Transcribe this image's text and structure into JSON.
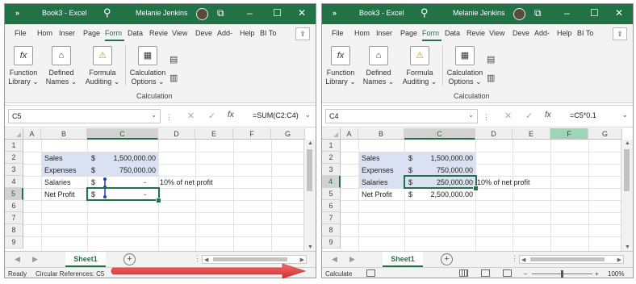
{
  "colors": {
    "excel_green": "#217346",
    "selected_band": "#d9e1f2",
    "tracer_blue": "#1f3fbf",
    "arrow_red": "#e03b3b"
  },
  "app": {
    "chevron": "»",
    "doc_title": "Book3 - Excel",
    "search_icon": "⚲",
    "user_name": "Melanie Jenkins",
    "restore_icon": "⧉",
    "minimize_icon": "–",
    "maximize_icon": "☐",
    "close_icon": "✕"
  },
  "menu": [
    "File",
    "Hom",
    "Inser",
    "Page",
    "Form",
    "Data",
    "Revie",
    "View",
    "Deve",
    "Add-",
    "Help",
    "BI To"
  ],
  "share_icon": "⇪",
  "ribbon": {
    "function_library": "Function Library ⌄",
    "function_library_l1": "Function",
    "function_library_l2": "Library ⌄",
    "defined_names_l1": "Defined",
    "defined_names_l2": "Names ⌄",
    "formula_auditing_l1": "Formula",
    "formula_auditing_l2": "Auditing ⌄",
    "calc_options_l1": "Calculation",
    "calc_options_l2": "Options ⌄",
    "group_label": "Calculation",
    "fx_icon": "fx",
    "names_icon": "⌂",
    "auditing_icon": "⚠",
    "calc_icon": "▦",
    "calc_now_icon": "▤",
    "calc_sheet_icon": "▥"
  },
  "formula_bar": {
    "dropdown": "⌄",
    "dots": "⋮",
    "cancel": "✕",
    "enter": "✓",
    "fx": "fx"
  },
  "columns": [
    "A",
    "B",
    "C",
    "D",
    "E",
    "F",
    "G"
  ],
  "rows": [
    "1",
    "2",
    "3",
    "4",
    "5",
    "6",
    "7",
    "8",
    "9"
  ],
  "left": {
    "name_box": "C5",
    "formula": "=SUM(C2:C4)",
    "cells": {
      "b2": "Sales",
      "b3": "Expenses",
      "b4": "Salaries",
      "b5": "Net Profit",
      "c_currency": "$",
      "c2": "1,500,000.00",
      "c3": "750,000.00",
      "c4": "-",
      "c5": "-",
      "d4": "10% of net profit"
    },
    "status": {
      "ready": "Ready",
      "circular": "Circular References: C5"
    }
  },
  "right": {
    "name_box": "C4",
    "formula": "=C5*0.1",
    "cells": {
      "b2": "Sales",
      "b3": "Expenses",
      "b4": "Salaries",
      "b5": "Net Profit",
      "c_currency": "$",
      "c2": "1,500,000.00",
      "c3": "750,000.00",
      "c4": "250,000.00",
      "c5": "2,500,000.00",
      "d4": "10% of net profit"
    },
    "status": {
      "calculate": "Calculate",
      "zoom": "100%",
      "minus": "–",
      "plus": "+"
    }
  },
  "sheet_tab": "Sheet1",
  "add_sheet": "+",
  "nav_left": "◀",
  "nav_right": "▶",
  "scroll": {
    "up": "▲",
    "down": "▼",
    "left": "◀",
    "right": "▶"
  }
}
